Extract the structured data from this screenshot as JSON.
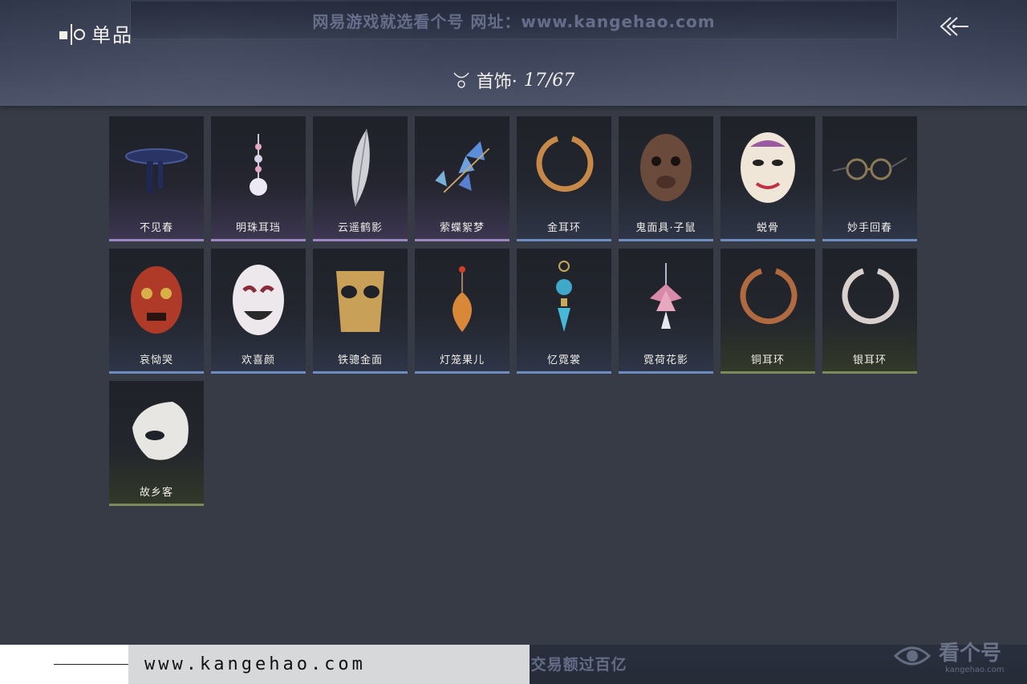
{
  "header": {
    "title": "单品",
    "watermark_top": "网易游戏就选看个号   网址：www.kangehao.com",
    "category_label": "首饰·",
    "category_count": "17/67"
  },
  "items": [
    {
      "name": "不见春",
      "rarity": "purple",
      "icon": "dark-collar-icon"
    },
    {
      "name": "明珠耳珰",
      "rarity": "purple",
      "icon": "pearl-earring-icon"
    },
    {
      "name": "云遥鹤影",
      "rarity": "purple",
      "icon": "feather-icon"
    },
    {
      "name": "萦蝶絮梦",
      "rarity": "purple",
      "icon": "butterfly-icon"
    },
    {
      "name": "金耳环",
      "rarity": "blue",
      "icon": "gold-hoop-icon"
    },
    {
      "name": "鬼面具·子鼠",
      "rarity": "blue",
      "icon": "rat-mask-icon"
    },
    {
      "name": "蜕骨",
      "rarity": "blue",
      "icon": "white-mask-icon"
    },
    {
      "name": "妙手回春",
      "rarity": "blue",
      "icon": "spectacles-icon"
    },
    {
      "name": "哀恸哭",
      "rarity": "blue",
      "icon": "red-mask-icon"
    },
    {
      "name": "欢喜颜",
      "rarity": "blue",
      "icon": "smile-mask-icon"
    },
    {
      "name": "铁骢金面",
      "rarity": "blue",
      "icon": "gold-mask-icon"
    },
    {
      "name": "灯笼果儿",
      "rarity": "blue",
      "icon": "lantern-fruit-icon"
    },
    {
      "name": "忆霓裳",
      "rarity": "blue",
      "icon": "gem-earring-icon"
    },
    {
      "name": "霓荷花影",
      "rarity": "blue",
      "icon": "lotus-earring-icon"
    },
    {
      "name": "铜耳环",
      "rarity": "green",
      "icon": "copper-hoop-icon"
    },
    {
      "name": "银耳环",
      "rarity": "green",
      "icon": "silver-hoop-icon"
    },
    {
      "name": "故乡客",
      "rarity": "green",
      "icon": "half-mask-icon"
    }
  ],
  "footer": {
    "url": "www.kangehao.com",
    "watermark_bottom": "看个号专业网易游戏八年   年交易额过百亿",
    "brand": "看个号",
    "brand_sub": "kangehao.com"
  }
}
